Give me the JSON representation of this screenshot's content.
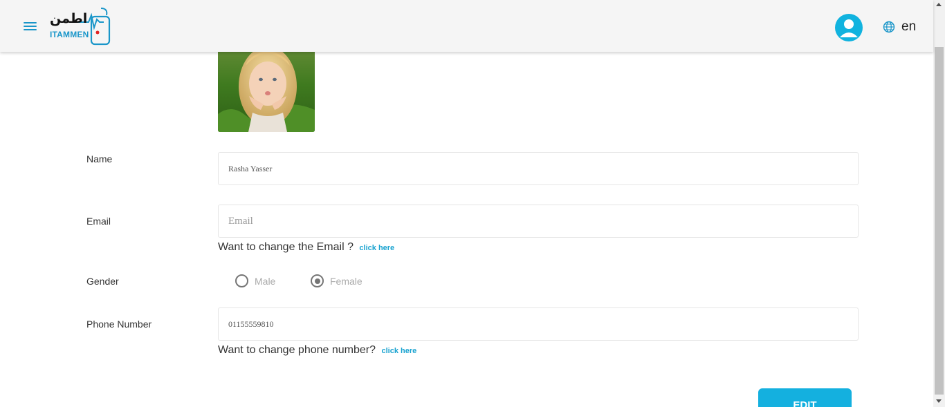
{
  "header": {
    "logo_ar": "اطمن",
    "logo_en": "ITAMMEN",
    "language": "en",
    "accent_color": "#14b0df"
  },
  "profile": {
    "photo_alt": "profile photo",
    "name": {
      "label": "Name",
      "value": "Rasha Yasser"
    },
    "email": {
      "label": "Email",
      "value": "",
      "placeholder": "Email",
      "hint": "Want to change the Email ?",
      "link": "click here"
    },
    "gender": {
      "label": "Gender",
      "options": [
        {
          "label": "Male",
          "checked": false
        },
        {
          "label": "Female",
          "checked": true
        }
      ]
    },
    "phone": {
      "label": "Phone Number",
      "value": "01155559810",
      "hint": "Want to change phone number?",
      "link": "click here"
    },
    "edit_label": "EDIT"
  }
}
